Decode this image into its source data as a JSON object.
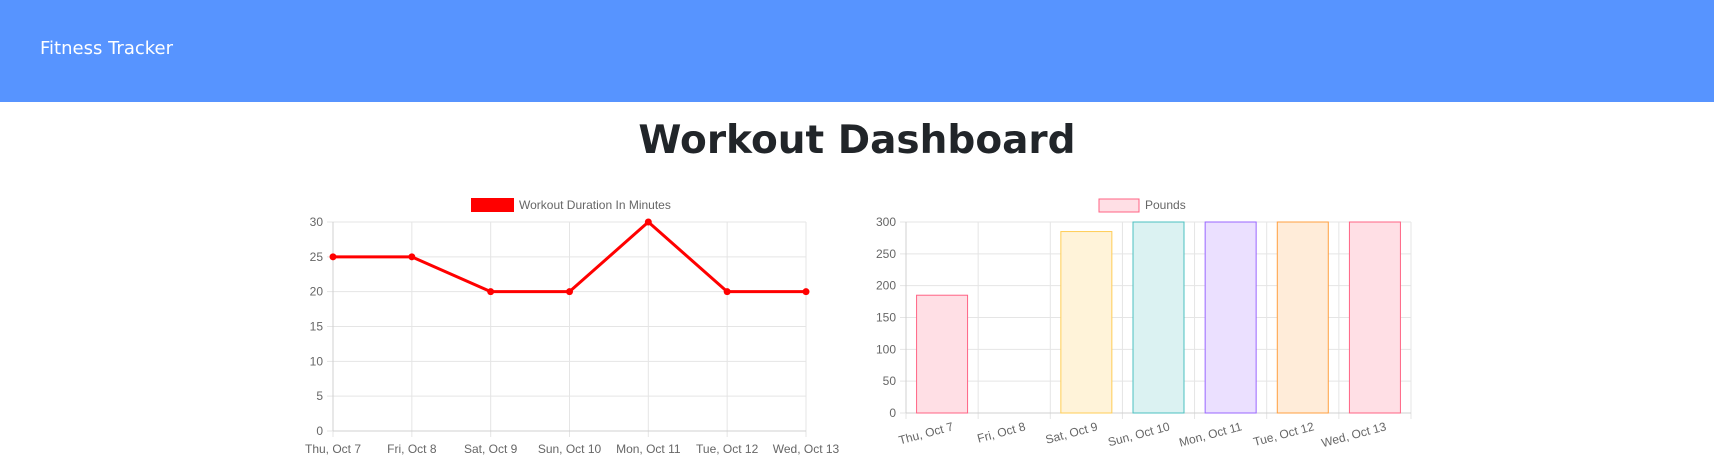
{
  "app": {
    "brand": "Fitness Tracker"
  },
  "page": {
    "title": "Workout Dashboard"
  },
  "chart_data": [
    {
      "type": "line",
      "categories": [
        "Thu, Oct 7",
        "Fri, Oct 8",
        "Sat, Oct 9",
        "Sun, Oct 10",
        "Mon, Oct 11",
        "Tue, Oct 12",
        "Wed, Oct 13"
      ],
      "series": [
        {
          "name": "Workout Duration In Minutes",
          "values": [
            25,
            25,
            20,
            20,
            30,
            20,
            20
          ],
          "color": "#ff0000"
        }
      ],
      "yticks": [
        "30",
        "25",
        "20",
        "15",
        "10",
        "5",
        "0"
      ],
      "ylim": [
        0,
        30
      ],
      "grid": true,
      "legend": "top-center"
    },
    {
      "type": "bar",
      "categories": [
        "Thu, Oct 7",
        "Fri, Oct 8",
        "Sat, Oct 9",
        "Sun, Oct 10",
        "Mon, Oct 11",
        "Tue, Oct 12",
        "Wed, Oct 13"
      ],
      "series": [
        {
          "name": "Pounds",
          "values": [
            185,
            0,
            285,
            300,
            300,
            300,
            300
          ]
        }
      ],
      "bar_fills": [
        "#ffdfe5",
        "#ffdfe5",
        "#fff3d9",
        "#dbf2f2",
        "#ebe0ff",
        "#ffecd9",
        "#ffdfe5"
      ],
      "bar_strokes": [
        "#ff6384",
        "#ff6384",
        "#ffcd56",
        "#4bc0c0",
        "#9966ff",
        "#ff9f40",
        "#ff6384"
      ],
      "yticks": [
        "300",
        "250",
        "200",
        "150",
        "100",
        "50",
        "0"
      ],
      "ylim": [
        0,
        300
      ],
      "grid": true,
      "legend": "top-center"
    }
  ]
}
